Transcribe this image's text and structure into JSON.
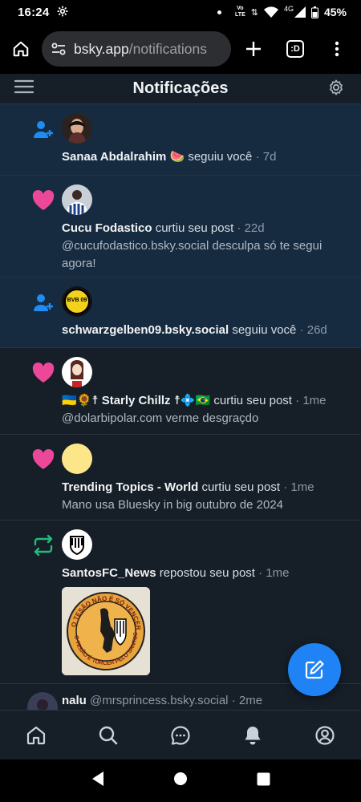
{
  "status_bar": {
    "time": "16:24",
    "battery": "45%",
    "network": "4G",
    "volte_top": "Vo",
    "volte_bottom": "LTE"
  },
  "browser": {
    "url_domain": "bsky.app",
    "url_path": "/notifications"
  },
  "header": {
    "title": "Notificações"
  },
  "notifications": [
    {
      "type": "follow",
      "unread": true,
      "name": "Sanaa Abdalrahim 🍉",
      "action": "seguiu você",
      "time": "· 7d",
      "text": ""
    },
    {
      "type": "like",
      "unread": true,
      "name": "Cucu Fodastico",
      "action": "curtiu seu post",
      "time": "· 22d",
      "text": "@cucufodastico.bsky.social desculpa só te segui agora!"
    },
    {
      "type": "follow",
      "unread": true,
      "name": "schwarzgelben09.bsky.social",
      "action": "seguiu você",
      "time": "· 26d",
      "text": ""
    },
    {
      "type": "like",
      "unread": false,
      "name": "🇺🇦🌻☨ Starly Chillz ☨💠🇧🇷",
      "action": "curtiu seu post",
      "time": "· 1me",
      "text": "@dolarbipolar.com verme desgraçdo"
    },
    {
      "type": "like",
      "unread": false,
      "name": "Trending Topics - World",
      "action": "curtiu seu post",
      "time": "· 1me",
      "text": "Mano usa Bluesky in big outubro de 2024"
    },
    {
      "type": "repost",
      "unread": false,
      "name": "SantosFC_News",
      "action": "repostou seu post",
      "time": "· 1me",
      "text": ""
    },
    {
      "type": "post",
      "unread": false,
      "name": "nalu",
      "action": "@mrsprincess.bsky.social",
      "time": "· 2me",
      "text": ""
    }
  ],
  "embed_image": {
    "top_text": "O TESÃO NÃO É SÓ VENCER",
    "bottom_text": "O TESÃO É TORCER PELO SANTOS F.C."
  },
  "avatar_badge": {
    "text": "BVB 09"
  },
  "colors": {
    "like": "#ec4899",
    "follow": "#1d8cf5",
    "repost": "#20bc7b",
    "accent": "#1f83f5",
    "unread_bg": "#172b40",
    "bg": "#161e27"
  }
}
